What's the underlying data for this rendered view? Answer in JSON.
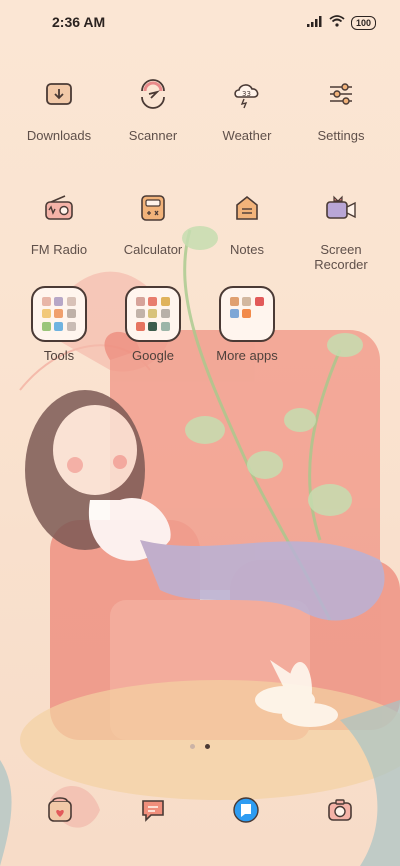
{
  "status_bar": {
    "time": "2:36 AM",
    "battery": "100"
  },
  "apps_row1": [
    {
      "label": "Downloads",
      "icon": "downloads-icon"
    },
    {
      "label": "Scanner",
      "icon": "scanner-icon"
    },
    {
      "label": "Weather",
      "icon": "weather-icon",
      "temp": "33"
    },
    {
      "label": "Settings",
      "icon": "settings-icon"
    }
  ],
  "apps_row2": [
    {
      "label": "FM Radio",
      "icon": "radio-icon"
    },
    {
      "label": "Calculator",
      "icon": "calculator-icon"
    },
    {
      "label": "Notes",
      "icon": "notes-icon"
    },
    {
      "label": "Screen Recorder",
      "icon": "screen-recorder-icon"
    }
  ],
  "folders": [
    {
      "label": "Tools"
    },
    {
      "label": "Google"
    },
    {
      "label": "More apps"
    }
  ],
  "dock": [
    {
      "icon": "phone-icon"
    },
    {
      "icon": "messages-icon"
    },
    {
      "icon": "browser-icon"
    },
    {
      "icon": "camera-icon"
    }
  ],
  "colors": {
    "background": "#fae3d0",
    "icon_outline": "#4a3a35",
    "accent_pink": "#e98a8a",
    "accent_orange": "#f2b37a",
    "browser_blue": "#2e9cf2"
  }
}
